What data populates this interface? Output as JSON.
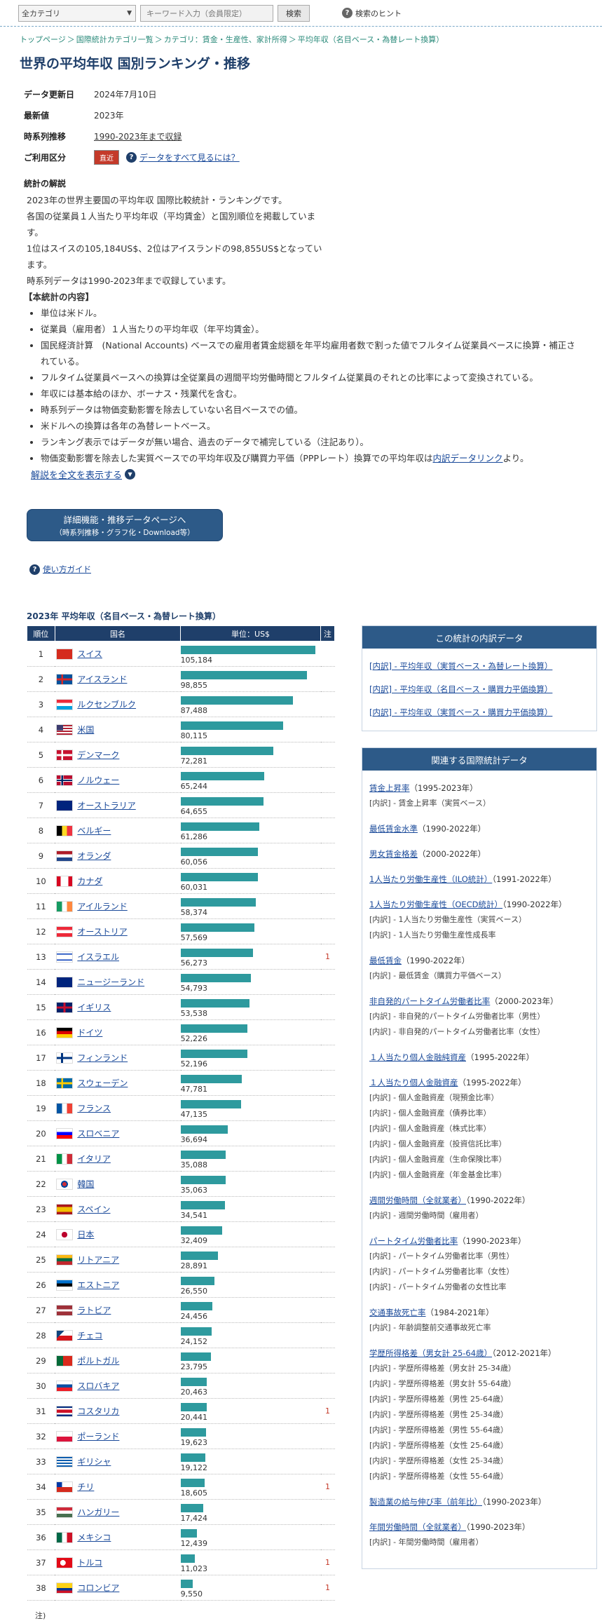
{
  "search": {
    "category": "全カテゴリ",
    "keyword_placeholder": "キーワード入力（会員限定）",
    "button": "検索",
    "hint": "検索のヒント"
  },
  "breadcrumb": [
    "トップページ",
    "国際統計カテゴリ一覧",
    "カテゴリ：賃金・生産性、家計所得",
    "平均年収（名目ベース・為替レート換算）"
  ],
  "title": "世界の平均年収 国別ランキング・推移",
  "meta": {
    "updated_label": "データ更新日",
    "updated": "2024年7月10日",
    "latest_label": "最新値",
    "latest": "2023年",
    "series_label": "時系列推移",
    "series": "1990-2023年まで収録",
    "usage_label": "ご利用区分",
    "usage_badge": "直近",
    "usage_link": "データをすべて見るには？"
  },
  "explanation": {
    "title": "統計の解説",
    "p1": "2023年の世界主要国の平均年収 国際比較統計・ランキングです。",
    "p2": "各国の従業員１人当たり平均年収（平均賃金）と国別順位を掲載していま",
    "p2b": "す。",
    "p3": "1位はスイスの105,184US$、2位はアイスランドの98,855US$となってい",
    "p3b": "ます。",
    "p4": "時系列データは1990-2023年まで収録しています。",
    "content_title": "【本統計の内容】",
    "bullets": [
      "単位は米ドル。",
      "従業員（雇用者）１人当たりの平均年収（年平均賃金）。",
      "国民経済計算　(National Accounts) ベースでの雇用者賃金総額を年平均雇用者数で割った値でフルタイム従業員ベースに換算・補正されている。",
      "フルタイム従業員ベースへの換算は全従業員の週間平均労働時間とフルタイム従業員のそれとの比率によって変換されている。",
      "年収には基本給のほか、ボーナス・残業代を含む。",
      "時系列データは物価変動影響を除去していない名目ベースでの値。",
      "米ドルへの換算は各年の為替レートベース。",
      "ランキング表示ではデータが無い場合、過去のデータで補完している（注記あり）。"
    ],
    "last_bullet_pre": "物価変動影響を除去した実質ベースでの平均年収及び購買力平価（PPPレート）換算での平均年収は",
    "last_bullet_link": "内訳データリンク",
    "last_bullet_post": "より。",
    "show_more": "解説を全文を表示する"
  },
  "detail_button": {
    "line1": "詳細機能・推移データページへ",
    "line2": "（時系列推移・グラフ化・Download等）"
  },
  "guide": "使い方ガイド",
  "ranking": {
    "title": "2023年 平均年収（名目ベース・為替レート換算）",
    "headers": [
      "順位",
      "国名",
      "単位：US$",
      "注"
    ],
    "rows": [
      {
        "rank": "1",
        "country": "スイス",
        "value": "105,184",
        "v": 105184,
        "note": "",
        "flag": "ch"
      },
      {
        "rank": "2",
        "country": "アイスランド",
        "value": "98,855",
        "v": 98855,
        "note": "",
        "flag": "is"
      },
      {
        "rank": "3",
        "country": "ルクセンブルク",
        "value": "87,488",
        "v": 87488,
        "note": "",
        "flag": "lu"
      },
      {
        "rank": "4",
        "country": "米国",
        "value": "80,115",
        "v": 80115,
        "note": "",
        "flag": "us"
      },
      {
        "rank": "5",
        "country": "デンマーク",
        "value": "72,281",
        "v": 72281,
        "note": "",
        "flag": "dk"
      },
      {
        "rank": "6",
        "country": "ノルウェー",
        "value": "65,244",
        "v": 65244,
        "note": "",
        "flag": "no"
      },
      {
        "rank": "7",
        "country": "オーストラリア",
        "value": "64,655",
        "v": 64655,
        "note": "",
        "flag": "au"
      },
      {
        "rank": "8",
        "country": "ベルギー",
        "value": "61,286",
        "v": 61286,
        "note": "",
        "flag": "be"
      },
      {
        "rank": "9",
        "country": "オランダ",
        "value": "60,056",
        "v": 60056,
        "note": "",
        "flag": "nl"
      },
      {
        "rank": "10",
        "country": "カナダ",
        "value": "60,031",
        "v": 60031,
        "note": "",
        "flag": "ca"
      },
      {
        "rank": "11",
        "country": "アイルランド",
        "value": "58,374",
        "v": 58374,
        "note": "",
        "flag": "ie"
      },
      {
        "rank": "12",
        "country": "オーストリア",
        "value": "57,569",
        "v": 57569,
        "note": "",
        "flag": "at"
      },
      {
        "rank": "13",
        "country": "イスラエル",
        "value": "56,273",
        "v": 56273,
        "note": "1",
        "flag": "il"
      },
      {
        "rank": "14",
        "country": "ニュージーランド",
        "value": "54,793",
        "v": 54793,
        "note": "",
        "flag": "nz"
      },
      {
        "rank": "15",
        "country": "イギリス",
        "value": "53,538",
        "v": 53538,
        "note": "",
        "flag": "gb"
      },
      {
        "rank": "16",
        "country": "ドイツ",
        "value": "52,226",
        "v": 52226,
        "note": "",
        "flag": "de"
      },
      {
        "rank": "17",
        "country": "フィンランド",
        "value": "52,196",
        "v": 52196,
        "note": "",
        "flag": "fi"
      },
      {
        "rank": "18",
        "country": "スウェーデン",
        "value": "47,781",
        "v": 47781,
        "note": "",
        "flag": "se"
      },
      {
        "rank": "19",
        "country": "フランス",
        "value": "47,135",
        "v": 47135,
        "note": "",
        "flag": "fr"
      },
      {
        "rank": "20",
        "country": "スロベニア",
        "value": "36,694",
        "v": 36694,
        "note": "",
        "flag": "si"
      },
      {
        "rank": "21",
        "country": "イタリア",
        "value": "35,088",
        "v": 35088,
        "note": "",
        "flag": "it"
      },
      {
        "rank": "22",
        "country": "韓国",
        "value": "35,063",
        "v": 35063,
        "note": "",
        "flag": "kr"
      },
      {
        "rank": "23",
        "country": "スペイン",
        "value": "34,541",
        "v": 34541,
        "note": "",
        "flag": "es"
      },
      {
        "rank": "24",
        "country": "日本",
        "value": "32,409",
        "v": 32409,
        "note": "",
        "flag": "jp"
      },
      {
        "rank": "25",
        "country": "リトアニア",
        "value": "28,891",
        "v": 28891,
        "note": "",
        "flag": "lt"
      },
      {
        "rank": "26",
        "country": "エストニア",
        "value": "26,550",
        "v": 26550,
        "note": "",
        "flag": "ee"
      },
      {
        "rank": "27",
        "country": "ラトビア",
        "value": "24,456",
        "v": 24456,
        "note": "",
        "flag": "lv"
      },
      {
        "rank": "28",
        "country": "チェコ",
        "value": "24,152",
        "v": 24152,
        "note": "",
        "flag": "cz"
      },
      {
        "rank": "29",
        "country": "ポルトガル",
        "value": "23,795",
        "v": 23795,
        "note": "",
        "flag": "pt"
      },
      {
        "rank": "30",
        "country": "スロバキア",
        "value": "20,463",
        "v": 20463,
        "note": "",
        "flag": "sk"
      },
      {
        "rank": "31",
        "country": "コスタリカ",
        "value": "20,441",
        "v": 20441,
        "note": "1",
        "flag": "cr"
      },
      {
        "rank": "32",
        "country": "ポーランド",
        "value": "19,623",
        "v": 19623,
        "note": "",
        "flag": "pl"
      },
      {
        "rank": "33",
        "country": "ギリシャ",
        "value": "19,122",
        "v": 19122,
        "note": "",
        "flag": "gr"
      },
      {
        "rank": "34",
        "country": "チリ",
        "value": "18,605",
        "v": 18605,
        "note": "1",
        "flag": "cl"
      },
      {
        "rank": "35",
        "country": "ハンガリー",
        "value": "17,424",
        "v": 17424,
        "note": "",
        "flag": "hu"
      },
      {
        "rank": "36",
        "country": "メキシコ",
        "value": "12,439",
        "v": 12439,
        "note": "",
        "flag": "mx"
      },
      {
        "rank": "37",
        "country": "トルコ",
        "value": "11,023",
        "v": 11023,
        "note": "1",
        "flag": "tr"
      },
      {
        "rank": "38",
        "country": "コロンビア",
        "value": "9,550",
        "v": 9550,
        "note": "1",
        "flag": "co"
      }
    ],
    "footnote": "注)"
  },
  "breakdown": {
    "title": "この統計の内訳データ",
    "links": [
      "[内訳] - 平均年収（実質ベース・為替レート換算）",
      "[内訳] - 平均年収（名目ベース・購買力平価換算）",
      "[内訳] - 平均年収（実質ベース・購買力平価換算）"
    ]
  },
  "related": {
    "title": "関連する国際統計データ",
    "groups": [
      {
        "name": "賃金上昇率",
        "years": "（1995-2023年）",
        "subs": [
          "[内訳] - 賃金上昇率（実質ベース）"
        ]
      },
      {
        "name": "最低賃金水準",
        "years": "（1990-2022年）",
        "subs": []
      },
      {
        "name": "男女賃金格差",
        "years": "（2000-2022年）",
        "subs": []
      },
      {
        "name": "1人当たり労働生産性（ILO統計）",
        "years": "（1991-2022年）",
        "subs": []
      },
      {
        "name": "1人当たり労働生産性（OECD統計）",
        "years": "（1990-2022年）",
        "subs": [
          "[内訳] - 1人当たり労働生産性（実質ベース）",
          "[内訳] - 1人当たり労働生産性成長率"
        ]
      },
      {
        "name": "最低賃金",
        "years": "（1990-2022年）",
        "subs": [
          "[内訳] - 最低賃金（購買力平価ベース）"
        ]
      },
      {
        "name": "非自発的パートタイム労働者比率",
        "years": "（2000-2023年）",
        "subs": [
          "[内訳] - 非自発的パートタイム労働者比率（男性）",
          "[内訳] - 非自発的パートタイム労働者比率（女性）"
        ]
      },
      {
        "name": "１人当たり個人金融純資産",
        "years": "（1995-2022年）",
        "subs": []
      },
      {
        "name": "１人当たり個人金融資産",
        "years": "（1995-2022年）",
        "subs": [
          "[内訳] - 個人金融資産（現預金比率）",
          "[内訳] - 個人金融資産（債券比率）",
          "[内訳] - 個人金融資産（株式比率）",
          "[内訳] - 個人金融資産（投資信託比率）",
          "[内訳] - 個人金融資産（生命保険比率）",
          "[内訳] - 個人金融資産（年金基金比率）"
        ]
      },
      {
        "name": "週間労働時間（全就業者）",
        "years": "（1990-2022年）",
        "subs": [
          "[内訳] - 週間労働時間（雇用者）"
        ]
      },
      {
        "name": "パートタイム労働者比率",
        "years": "（1990-2023年）",
        "subs": [
          "[内訳] - パートタイム労働者比率（男性）",
          "[内訳] - パートタイム労働者比率（女性）",
          "[内訳] - パートタイム労働者の女性比率"
        ]
      },
      {
        "name": "交通事故死亡率",
        "years": "（1984-2021年）",
        "subs": [
          "[内訳] - 年齢調整前交通事故死亡率"
        ]
      },
      {
        "name": "学歴所得格差（男女計 25-64歳）",
        "years": "（2012-2021年）",
        "subs": [
          "[内訳] - 学歴所得格差（男女計 25-34歳）",
          "[内訳] - 学歴所得格差（男女計 55-64歳）",
          "[内訳] - 学歴所得格差（男性 25-64歳）",
          "[内訳] - 学歴所得格差（男性 25-34歳）",
          "[内訳] - 学歴所得格差（男性 55-64歳）",
          "[内訳] - 学歴所得格差（女性 25-64歳）",
          "[内訳] - 学歴所得格差（女性 25-34歳）",
          "[内訳] - 学歴所得格差（女性 55-64歳）"
        ]
      },
      {
        "name": "製造業の給与伸び率（前年比）",
        "years": "（1990-2023年）",
        "subs": []
      },
      {
        "name": "年間労働時間（全就業者）",
        "years": "（1990-2023年）",
        "subs": [
          "[内訳] - 年間労働時間（雇用者）"
        ]
      }
    ]
  }
}
